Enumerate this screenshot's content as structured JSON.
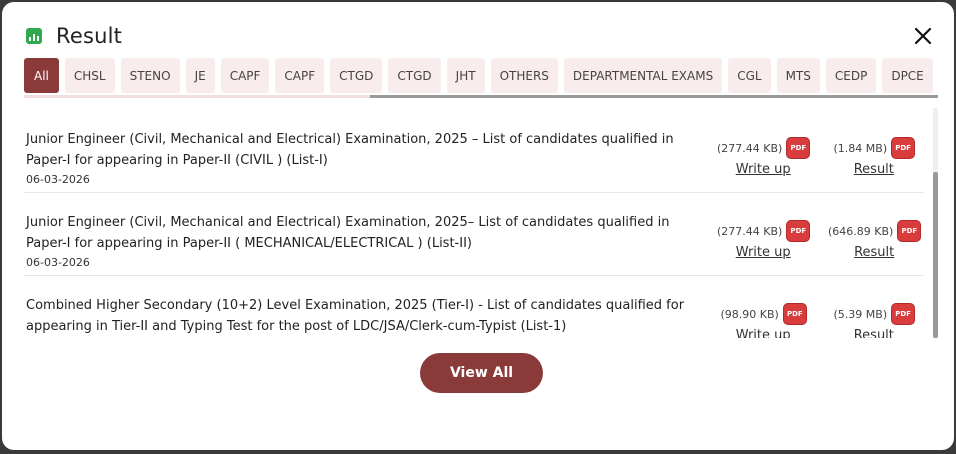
{
  "header": {
    "title": "Result",
    "icon": "bar-chart-icon",
    "icon_color": "#2fa84f",
    "close_icon": "close-icon"
  },
  "tabs": [
    {
      "label": "All",
      "active": true
    },
    {
      "label": "CHSL"
    },
    {
      "label": "STENO"
    },
    {
      "label": "JE"
    },
    {
      "label": "CAPF"
    },
    {
      "label": "CAPF"
    },
    {
      "label": "CTGD"
    },
    {
      "label": "CTGD"
    },
    {
      "label": "JHT"
    },
    {
      "label": "OTHERS"
    },
    {
      "label": "DEPARTMENTAL EXAMS"
    },
    {
      "label": "CGL"
    },
    {
      "label": "MTS"
    },
    {
      "label": "CEDP"
    },
    {
      "label": "DPCE"
    }
  ],
  "items": [
    {
      "text": "Junior Engineer (Civil, Mechanical and Electrical) Examination, 2025 – List of candidates qualified in Paper-I for appearing in Paper-II (CIVIL ) (List-I)",
      "date": "06-03-2026",
      "writeup": {
        "size": "(277.44 KB)",
        "label": "Write up"
      },
      "result": {
        "size": "(1.84 MB)",
        "label": "Result"
      }
    },
    {
      "text": "Junior Engineer (Civil, Mechanical and Electrical) Examination, 2025– List of candidates qualified in Paper-I for appearing in Paper-II ( MECHANICAL/ELECTRICAL ) (List-II)",
      "date": "06-03-2026",
      "writeup": {
        "size": "(277.44 KB)",
        "label": "Write up"
      },
      "result": {
        "size": "(646.89 KB)",
        "label": "Result"
      }
    },
    {
      "text": "Combined Higher Secondary (10+2) Level Examination, 2025 (Tier-I) - List of candidates qualified for appearing in Tier-II and Typing Test for the post of LDC/JSA/Clerk-cum-Typist (List-1)",
      "date": "",
      "writeup": {
        "size": "(98.90 KB)",
        "label": "Write up"
      },
      "result": {
        "size": "(5.39 MB)",
        "label": "Result"
      }
    }
  ],
  "pdf_badge": "PDF",
  "view_all_label": "View All",
  "colors": {
    "accent": "#8b3a3a",
    "pdf": "#d93c3c",
    "tab_bg": "#f9ecec"
  }
}
